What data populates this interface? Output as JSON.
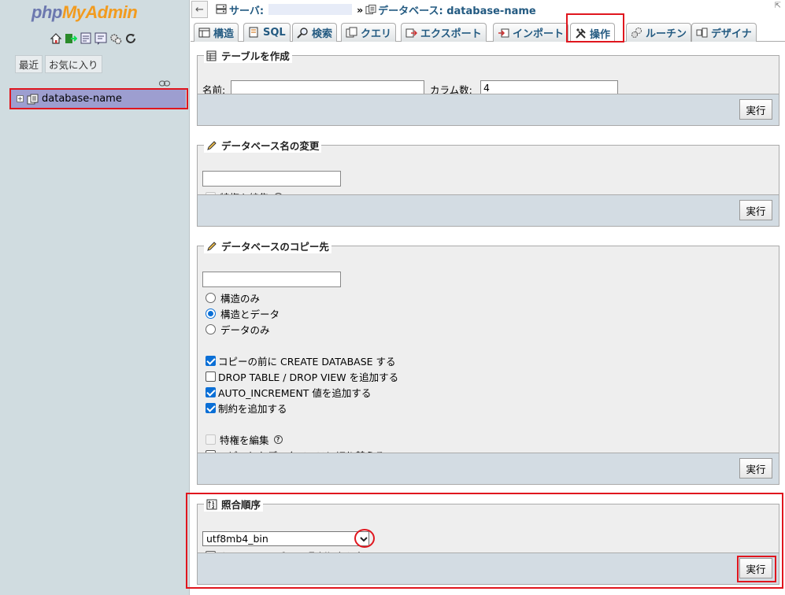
{
  "nav": {
    "logo_part1": "php",
    "logo_part2": "MyAdmin",
    "icons": [
      "home-icon",
      "logout-icon",
      "docs-icon",
      "sql-docs-icon",
      "settings-icon",
      "reload-icon"
    ],
    "tabs": [
      "最近",
      "お気に入り"
    ],
    "db_item": "database-name"
  },
  "breadcrumb": {
    "server_label": "サーバ:",
    "sep": "»",
    "database_label": "データベース: database-name"
  },
  "tabs": [
    {
      "label": "構造",
      "icon": "structure-icon"
    },
    {
      "label": "SQL",
      "icon": "sql-icon"
    },
    {
      "label": "検索",
      "icon": "search-icon"
    },
    {
      "label": "クエリ",
      "icon": "query-icon"
    },
    {
      "label": "エクスポート",
      "icon": "export-icon"
    },
    {
      "label": "インポート",
      "icon": "import-icon"
    },
    {
      "label": "操作",
      "icon": "operations-icon",
      "active": true
    },
    {
      "label": "ルーチン",
      "icon": "routines-icon"
    },
    {
      "label": "デザイナ",
      "icon": "designer-icon"
    }
  ],
  "create_table": {
    "legend": "テーブルを作成",
    "name_label": "名前:",
    "name_value": "",
    "columns_label": "カラム数:",
    "columns_value": "4",
    "go": "実行"
  },
  "rename_db": {
    "legend": "データベース名の変更",
    "value": "",
    "adjust_privileges": "特権を編集",
    "go": "実行"
  },
  "copy_db": {
    "legend": "データベースのコピー先",
    "value": "",
    "radios": [
      {
        "label": "構造のみ",
        "checked": false
      },
      {
        "label": "構造とデータ",
        "checked": true
      },
      {
        "label": "データのみ",
        "checked": false
      }
    ],
    "checkboxes": [
      {
        "label": "コピーの前に CREATE DATABASE する",
        "checked": true
      },
      {
        "label": "DROP TABLE / DROP VIEW を追加する",
        "checked": false
      },
      {
        "label": "AUTO_INCREMENT 値を追加する",
        "checked": true
      },
      {
        "label": "制約を追加する",
        "checked": true
      }
    ],
    "adjust_privileges": "特権を編集",
    "switch_db": "コピーしたデータベースに切り替える",
    "go": "実行"
  },
  "collation": {
    "legend": "照合順序",
    "selected": "utf8mb4_bin",
    "change_all": "すべてのテーブルの照合順序を変更",
    "go": "実行"
  }
}
